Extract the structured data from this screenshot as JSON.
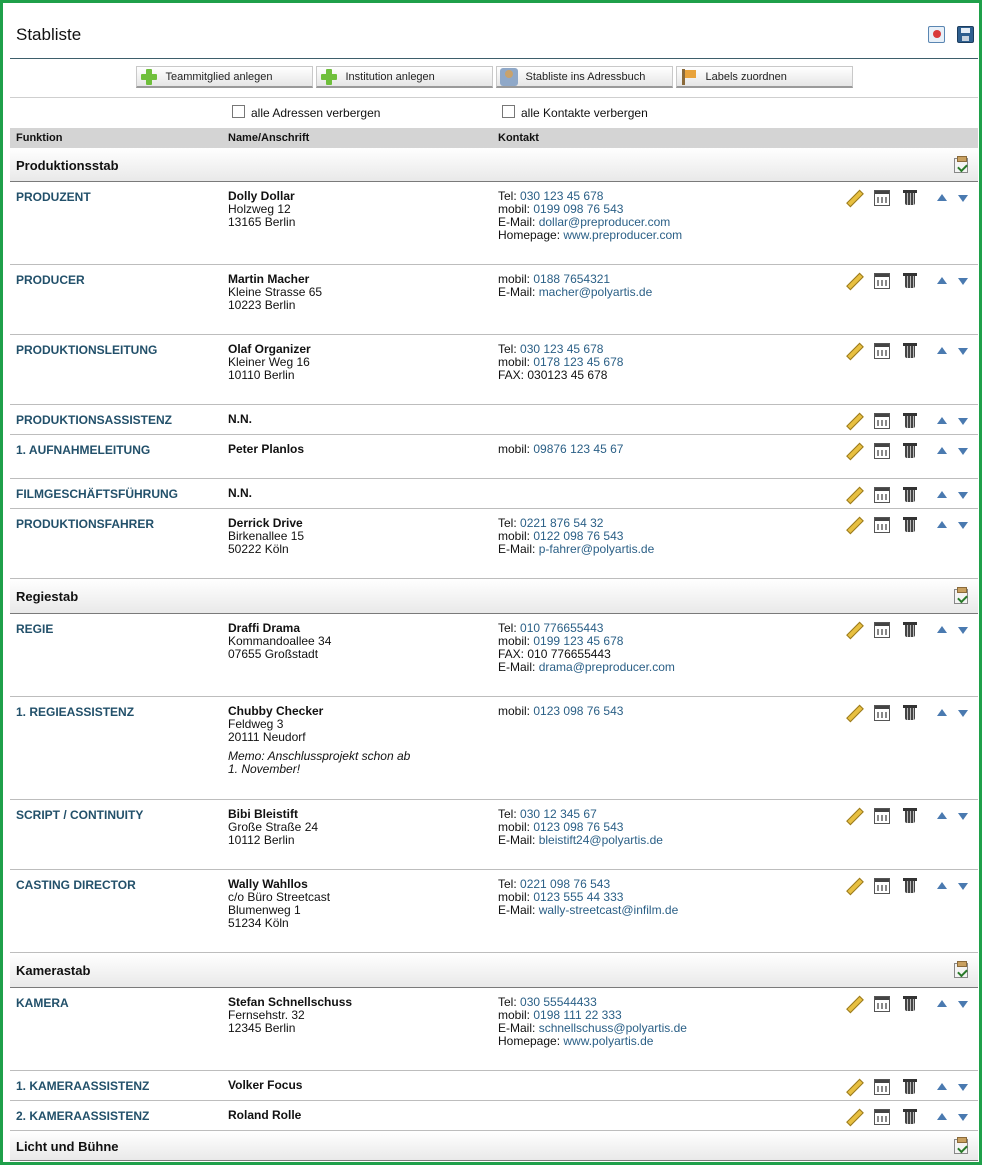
{
  "title": "Stabliste",
  "title_icons": [
    "pdf-icon",
    "save-icon"
  ],
  "toolbar": [
    {
      "label": "Teammitglied  anlegen",
      "icon": "plus-icon"
    },
    {
      "label": "Institution  anlegen",
      "icon": "plus-icon"
    },
    {
      "label": "Stabliste  ins  Adressbuch",
      "icon": "addressbook-icon"
    },
    {
      "label": "Labels  zuordnen",
      "icon": "label-icon"
    }
  ],
  "checkboxes": {
    "hide_addresses": "alle Adressen verbergen",
    "hide_contacts": "alle Kontakte verbergen"
  },
  "columns": {
    "function": "Funktion",
    "name": "Name/Anschrift",
    "contact": "Kontakt"
  },
  "sections": [
    {
      "title": "Produktionsstab",
      "rows": [
        {
          "function": "PRODUZENT",
          "name": "Dolly Dollar",
          "address": [
            "Holzweg 12",
            "13165 Berlin"
          ],
          "memo": [],
          "contacts": [
            {
              "label": "Tel:",
              "value": "030 123 45 678",
              "link": true
            },
            {
              "label": "mobil:",
              "value": "0199 098 76 543",
              "link": true
            },
            {
              "label": "E-Mail:",
              "value": "dollar@preproducer.com",
              "link": true
            },
            {
              "label": "Homepage:",
              "value": "www.preproducer.com",
              "link": true
            }
          ]
        },
        {
          "function": "PRODUCER",
          "name": "Martin Macher",
          "address": [
            "Kleine Strasse 65",
            "10223 Berlin"
          ],
          "memo": [],
          "contacts": [
            {
              "label": "mobil:",
              "value": "0188 7654321",
              "link": true
            },
            {
              "label": "E-Mail:",
              "value": "macher@polyartis.de",
              "link": true
            }
          ]
        },
        {
          "function": "PRODUKTIONSLEITUNG",
          "name": "Olaf Organizer",
          "address": [
            "Kleiner Weg 16",
            "10110 Berlin"
          ],
          "memo": [],
          "contacts": [
            {
              "label": "Tel:",
              "value": "030 123 45 678",
              "link": true
            },
            {
              "label": "mobil:",
              "value": "0178 123 45 678",
              "link": true
            },
            {
              "label": "FAX:",
              "value": "030123 45 678",
              "link": false
            }
          ]
        },
        {
          "function": "PRODUKTIONSASSISTENZ",
          "name": "N.N.",
          "address": [],
          "memo": [],
          "contacts": []
        },
        {
          "function": "1. AUFNAHMELEITUNG",
          "name": "Peter Planlos",
          "address": [],
          "memo": [],
          "contacts": [
            {
              "label": "mobil:",
              "value": "09876 123 45 67",
              "link": true
            }
          ]
        },
        {
          "function": "FILMGESCHÄFTSFÜHRUNG",
          "name": "N.N.",
          "address": [],
          "memo": [],
          "contacts": []
        },
        {
          "function": "PRODUKTIONSFAHRER",
          "name": "Derrick Drive",
          "address": [
            "Birkenallee 15",
            "50222 Köln"
          ],
          "memo": [],
          "contacts": [
            {
              "label": "Tel:",
              "value": "0221 876 54 32",
              "link": true
            },
            {
              "label": "mobil:",
              "value": "0122 098 76 543",
              "link": true
            },
            {
              "label": "E-Mail:",
              "value": "p-fahrer@polyartis.de",
              "link": true
            }
          ]
        }
      ]
    },
    {
      "title": "Regiestab",
      "rows": [
        {
          "function": "REGIE",
          "name": "Draffi Drama",
          "address": [
            "Kommandoallee 34",
            "07655 Großstadt"
          ],
          "memo": [],
          "contacts": [
            {
              "label": "Tel:",
              "value": "010 776655443",
              "link": true
            },
            {
              "label": "mobil:",
              "value": "0199 123 45 678",
              "link": true
            },
            {
              "label": "FAX:",
              "value": "010 776655443",
              "link": false
            },
            {
              "label": "E-Mail:",
              "value": "drama@preproducer.com",
              "link": true
            }
          ]
        },
        {
          "function": "1. REGIEASSISTENZ",
          "name": "Chubby Checker",
          "address": [
            "Feldweg 3",
            "20111 Neudorf"
          ],
          "memo": [
            "Memo: Anschlussprojekt schon ab",
            "1. November!"
          ],
          "contacts": [
            {
              "label": "mobil:",
              "value": "0123 098 76 543",
              "link": true
            }
          ]
        },
        {
          "function": "SCRIPT / CONTINUITY",
          "name": "Bibi Bleistift",
          "address": [
            "Große Straße 24",
            "10112 Berlin"
          ],
          "memo": [],
          "contacts": [
            {
              "label": "Tel:",
              "value": "030 12 345 67",
              "link": true
            },
            {
              "label": "mobil:",
              "value": "0123 098 76 543",
              "link": true
            },
            {
              "label": "E-Mail:",
              "value": "bleistift24@polyartis.de",
              "link": true
            }
          ]
        },
        {
          "function": "CASTING DIRECTOR",
          "name": "Wally Wahllos",
          "address": [
            "c/o Büro Streetcast",
            "Blumenweg 1",
            "51234 Köln"
          ],
          "memo": [],
          "contacts": [
            {
              "label": "Tel:",
              "value": "0221 098 76 543",
              "link": true
            },
            {
              "label": "mobil:",
              "value": "0123 555 44 333",
              "link": true
            },
            {
              "label": "E-Mail:",
              "value": "wally-streetcast@infilm.de",
              "link": true
            }
          ]
        }
      ]
    },
    {
      "title": "Kamerastab",
      "rows": [
        {
          "function": "KAMERA",
          "name": "Stefan Schnellschuss",
          "address": [
            "Fernsehstr. 32",
            "12345 Berlin"
          ],
          "memo": [],
          "contacts": [
            {
              "label": "Tel:",
              "value": "030 55544433",
              "link": true
            },
            {
              "label": "mobil:",
              "value": "0198 111 22 333",
              "link": true
            },
            {
              "label": "E-Mail:",
              "value": "schnellschuss@polyartis.de",
              "link": true
            },
            {
              "label": "Homepage:",
              "value": "www.polyartis.de",
              "link": true
            }
          ]
        },
        {
          "function": "1. KAMERAASSISTENZ",
          "name": "Volker Focus",
          "address": [],
          "memo": [],
          "contacts": []
        },
        {
          "function": "2. KAMERAASSISTENZ",
          "name": "Roland Rolle",
          "address": [],
          "memo": [],
          "contacts": []
        }
      ]
    },
    {
      "title": "Licht und Bühne",
      "rows": []
    }
  ]
}
